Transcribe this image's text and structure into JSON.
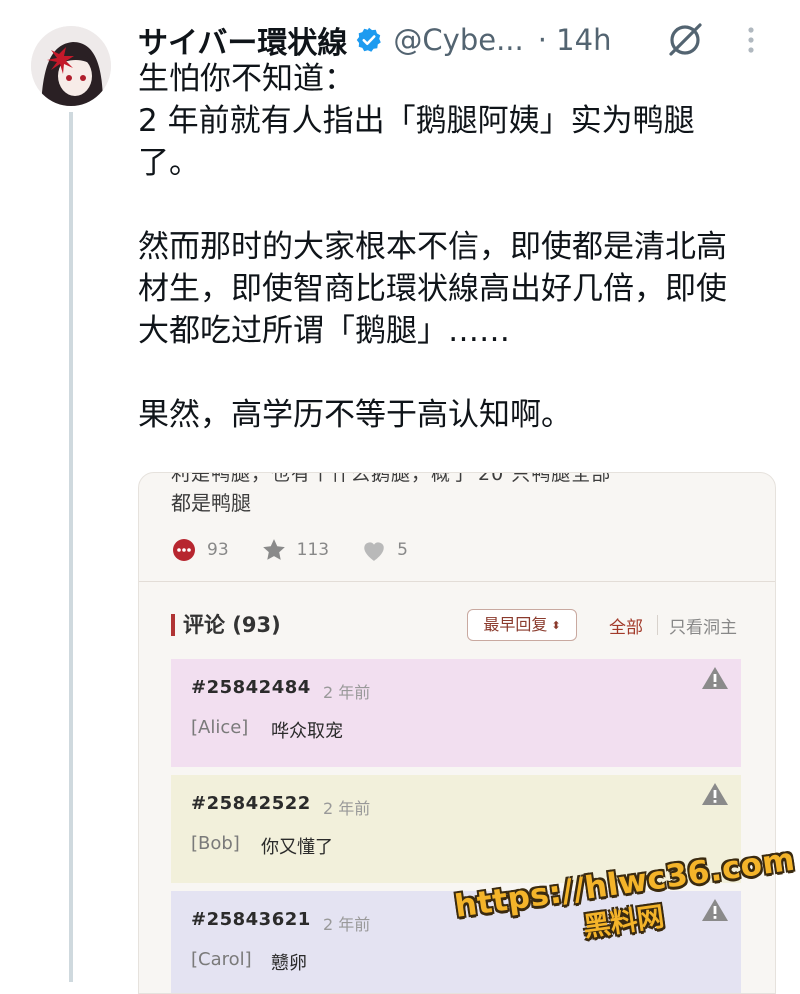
{
  "tweet": {
    "display_name": "サイバー環状線",
    "handle": "@Cybe...",
    "time": "· 14h",
    "lines": [
      "生怕你不知道：",
      "2 年前就有人指出「鹅腿阿姨」实为鸭腿",
      "了。",
      "",
      "然而那时的大家根本不信，即使都是清北高",
      "材生，即使智商比環状線高出好几倍，即使",
      "大都吃过所谓「鹅腿」……",
      "",
      "果然，高学历不等于高认知啊。"
    ]
  },
  "card": {
    "cut_text": "利是鸭腿，也有个什么鹅腿，概了 20 只鸭腿全部",
    "body_text": "都是鸭腿",
    "stats": {
      "comments": "93",
      "stars": "113",
      "likes": "5"
    },
    "comments_title": "评论 (93)",
    "sort_label": "最早回复",
    "tab_all": "全部",
    "tab_op": "只看洞主",
    "comments": [
      {
        "id": "#25842484",
        "time": "2 年前",
        "user": "[Alice]",
        "text": "哗众取宠",
        "bg": "#f2dff0"
      },
      {
        "id": "#25842522",
        "time": "2 年前",
        "user": "[Bob]",
        "text": "你又懂了",
        "bg": "#f2f0db"
      },
      {
        "id": "#25843621",
        "time": "2 年前",
        "user": "[Carol]",
        "text": "戆卵",
        "bg": "#e4e3f2"
      }
    ]
  },
  "watermark": {
    "url": "https://hlwc36.com",
    "sub": "黑料网"
  },
  "colors": {
    "accent": "#b03434",
    "verified": "#1d9bf0",
    "watermark": "#f4b42a"
  }
}
